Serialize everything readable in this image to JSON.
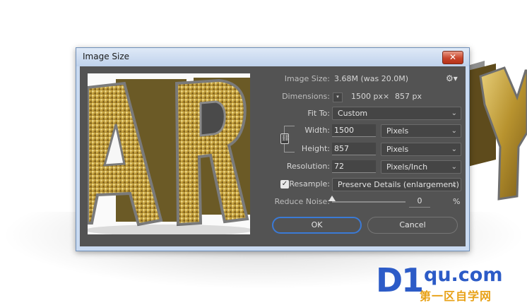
{
  "dialog": {
    "title": "Image Size",
    "close_label": "✕",
    "image_size": {
      "label": "Image Size:",
      "value": "3.68M (was 20.0M)"
    },
    "dimensions": {
      "label": "Dimensions:",
      "width": "1500 px",
      "times": "×",
      "height": "857 px"
    },
    "fit_to": {
      "label": "Fit To:",
      "value": "Custom"
    },
    "width": {
      "label": "Width:",
      "value": "1500",
      "unit": "Pixels"
    },
    "height": {
      "label": "Height:",
      "value": "857",
      "unit": "Pixels"
    },
    "resolution": {
      "label": "Resolution:",
      "value": "72",
      "unit": "Pixels/Inch"
    },
    "resample": {
      "label": "Resample:",
      "checked": true,
      "value": "Preserve Details (enlargement)"
    },
    "reduce_noise": {
      "label": "Reduce Noise:",
      "value": "0",
      "unit": "%",
      "level": 0
    },
    "ok_label": "OK",
    "cancel_label": "Cancel"
  },
  "watermark": {
    "d1": "D1",
    "domain": "qu.com",
    "cn": "第一区自学网"
  },
  "colors": {
    "dialog_bg": "#535353",
    "accent": "#3b7ad6",
    "gold": "#c9a648"
  }
}
